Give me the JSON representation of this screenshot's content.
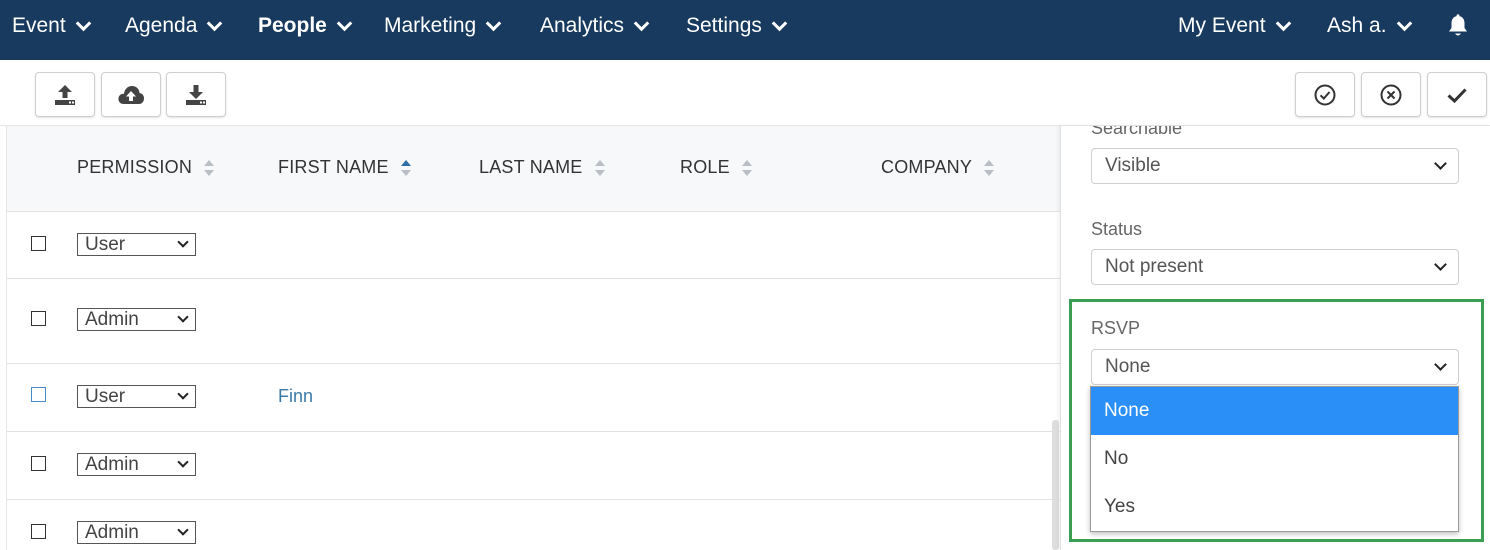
{
  "nav": {
    "items": [
      {
        "label": "Event"
      },
      {
        "label": "Agenda"
      },
      {
        "label": "People"
      },
      {
        "label": "Marketing"
      },
      {
        "label": "Analytics"
      },
      {
        "label": "Settings"
      }
    ],
    "event_label": "My Event",
    "user_label": "Ash a.",
    "bell_icon": "bell-icon",
    "active_item": "People",
    "background_color": "#173a5e"
  },
  "toolbar": {
    "left_buttons": [
      "upload-icon",
      "cloud-upload-icon",
      "download-icon"
    ],
    "right_buttons": [
      "check-circle-icon",
      "x-circle-icon",
      "checkmark-icon"
    ]
  },
  "table": {
    "columns": [
      {
        "label": "PERMISSION",
        "sort": "none"
      },
      {
        "label": "FIRST NAME",
        "sort": "asc"
      },
      {
        "label": "LAST NAME",
        "sort": "none"
      },
      {
        "label": "ROLE",
        "sort": "none"
      },
      {
        "label": "COMPANY",
        "sort": "none"
      }
    ],
    "rows": [
      {
        "permission": "User",
        "first_name": ""
      },
      {
        "permission": "Admin",
        "first_name": ""
      },
      {
        "permission": "User",
        "first_name": "Finn"
      },
      {
        "permission": "Admin",
        "first_name": ""
      },
      {
        "permission": "Admin",
        "first_name": ""
      }
    ]
  },
  "panel": {
    "searchable_label": "Searchable",
    "searchable_value": "Visible",
    "status_label": "Status",
    "status_value": "Not present",
    "rsvp_label": "RSVP",
    "rsvp_value": "None",
    "rsvp_options": [
      "None",
      "No",
      "Yes"
    ],
    "highlight_color": "#3a9f52",
    "selected_option_color": "#2a8ff7"
  }
}
